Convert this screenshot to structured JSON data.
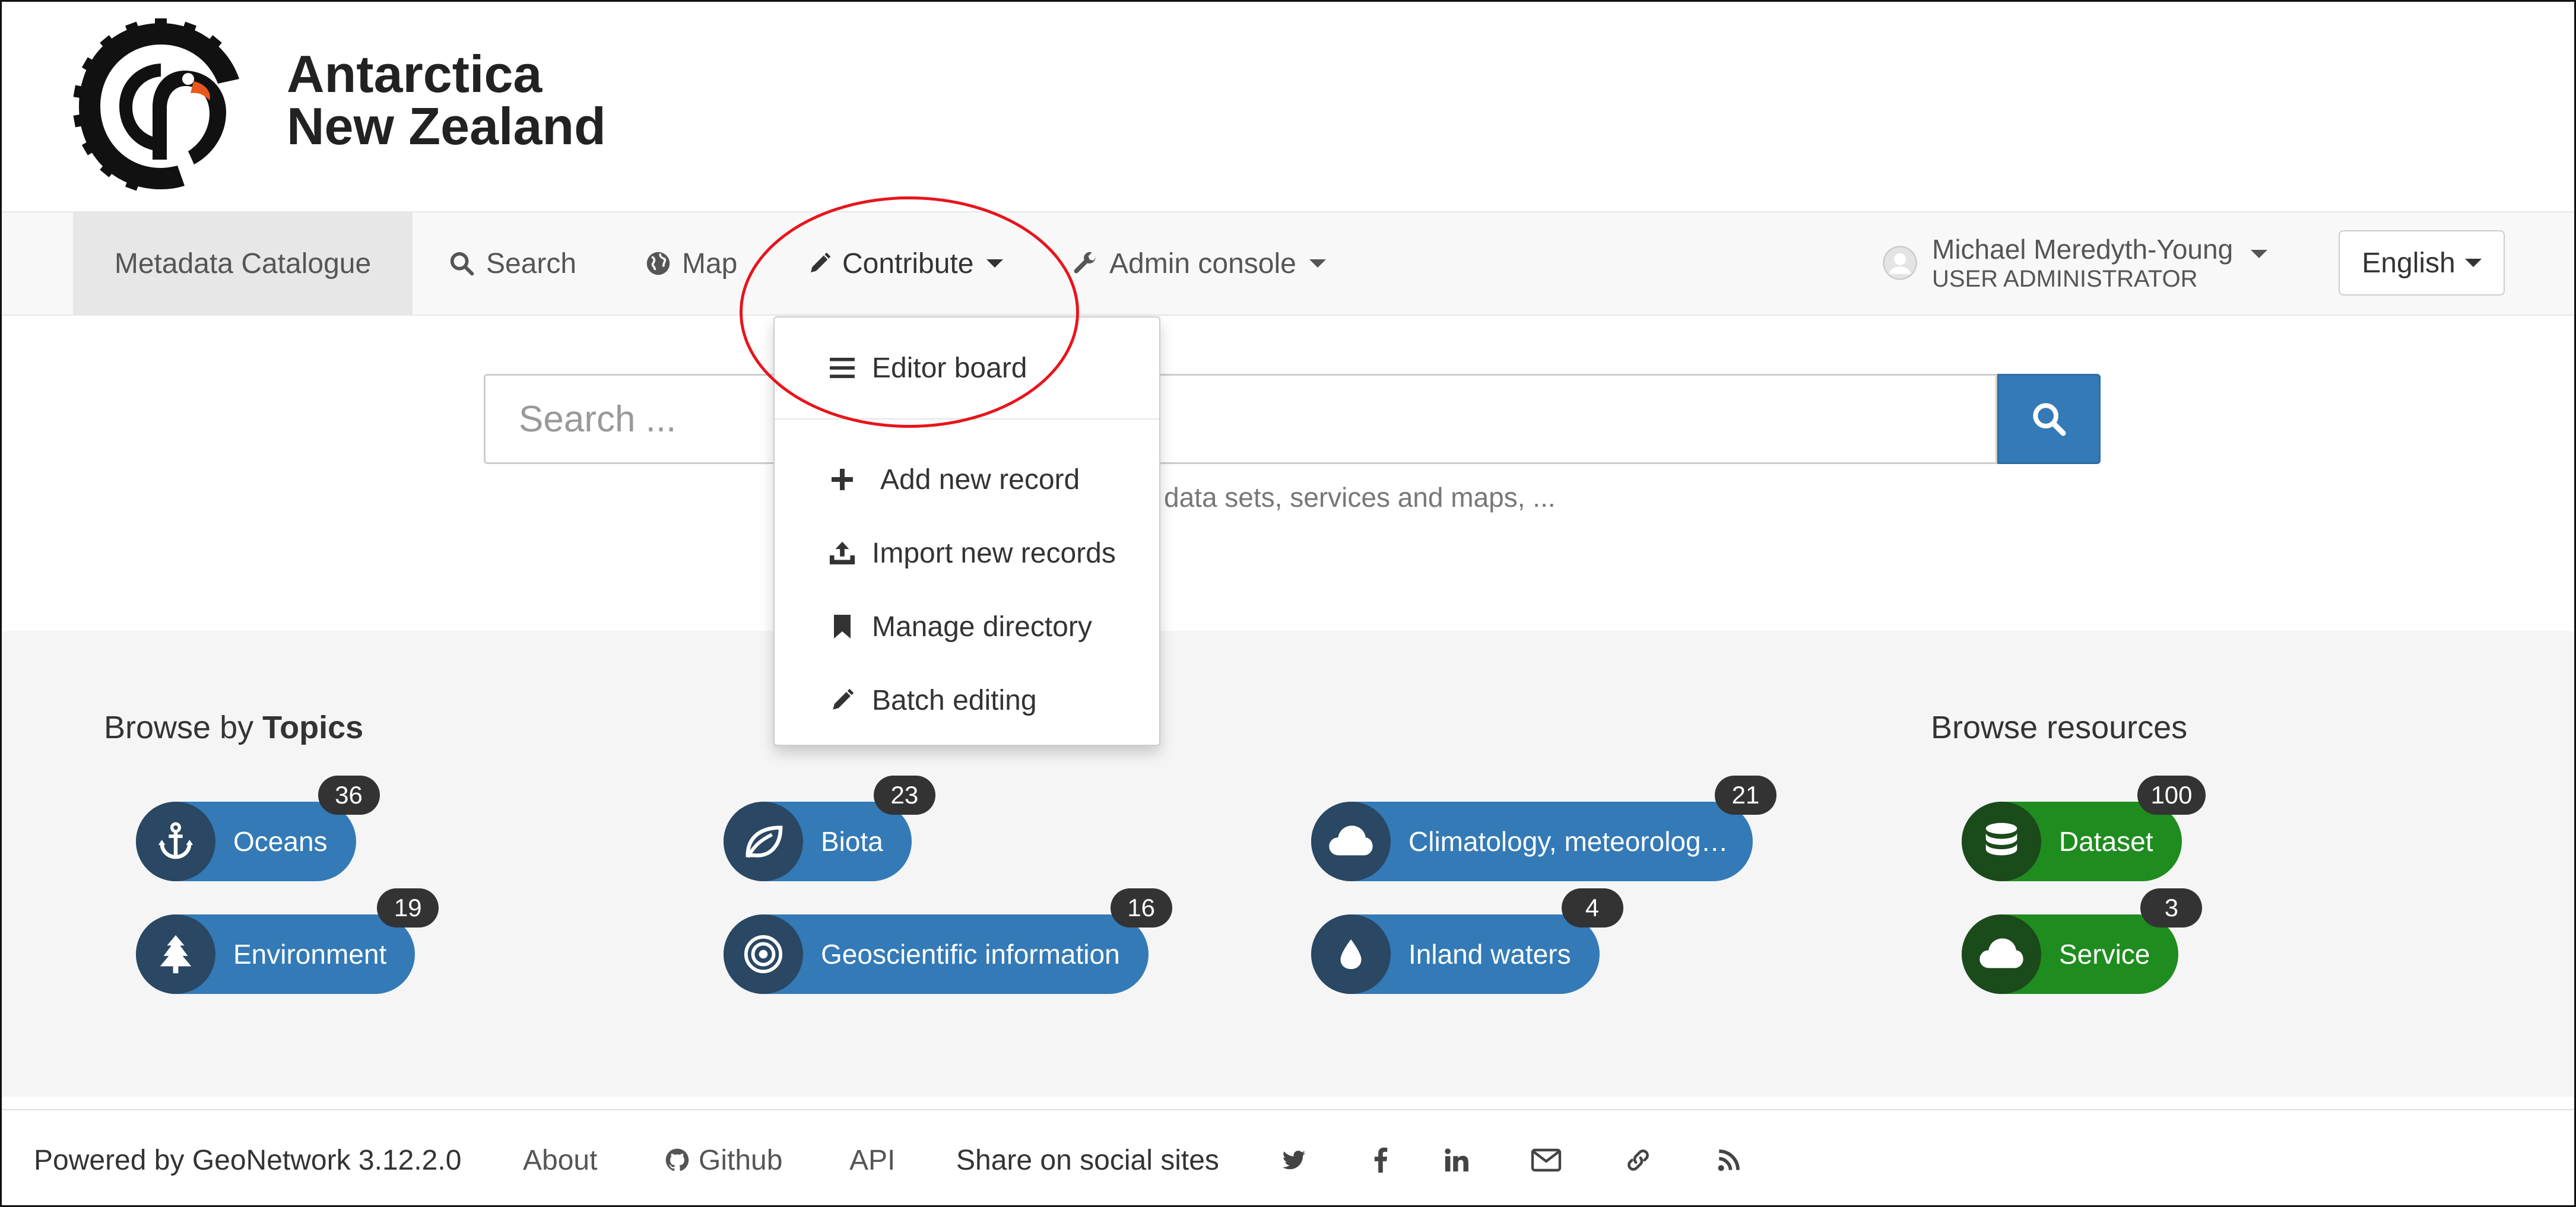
{
  "brand": {
    "line1": "Antarctica",
    "line2": "New Zealand",
    "logo_icon": "antarctica-nz-logo"
  },
  "nav": {
    "catalogue": "Metadata Catalogue",
    "search": "Search",
    "map": "Map",
    "contribute": "Contribute",
    "admin": "Admin console",
    "user_name": "Michael Meredyth-Young",
    "user_role": "USER ADMINISTRATOR",
    "language": "English"
  },
  "contribute_menu": {
    "items": [
      {
        "label": "Editor board",
        "icon": "list-icon"
      },
      {
        "label": "Add new record",
        "icon": "plus-icon"
      },
      {
        "label": "Import new records",
        "icon": "upload-icon"
      },
      {
        "label": "Manage directory",
        "icon": "bookmark-icon"
      },
      {
        "label": "Batch editing",
        "icon": "pencil-icon"
      }
    ]
  },
  "search": {
    "placeholder": "Search ...",
    "hint": "data sets, services and maps, ..."
  },
  "browse_topics": {
    "title_prefix": "Browse by",
    "title_bold": "Topics",
    "items": [
      {
        "label": "Oceans",
        "count": "36",
        "icon": "anchor-icon"
      },
      {
        "label": "Biota",
        "count": "23",
        "icon": "leaf-icon"
      },
      {
        "label": "Climatology, meteorolog…",
        "count": "21",
        "icon": "cloud-icon"
      },
      {
        "label": "Environment",
        "count": "19",
        "icon": "tree-icon"
      },
      {
        "label": "Geoscientific information",
        "count": "16",
        "icon": "target-icon"
      },
      {
        "label": "Inland waters",
        "count": "4",
        "icon": "water-drop-icon"
      }
    ]
  },
  "browse_resources": {
    "title": "Browse resources",
    "items": [
      {
        "label": "Dataset",
        "count": "100",
        "icon": "database-icon"
      },
      {
        "label": "Service",
        "count": "3",
        "icon": "cloud-icon"
      }
    ]
  },
  "footer": {
    "powered": "Powered by GeoNetwork 3.12.2.0",
    "about": "About",
    "github": "Github",
    "api": "API",
    "share": "Share on social sites"
  },
  "colors": {
    "topic_pill": "#337ab7",
    "topic_icon_bg": "#2a4763",
    "resource_pill": "#1f8c1f",
    "resource_icon_bg": "#1b4a1b",
    "search_button": "#337ab7",
    "annotation": "#e8141c"
  }
}
